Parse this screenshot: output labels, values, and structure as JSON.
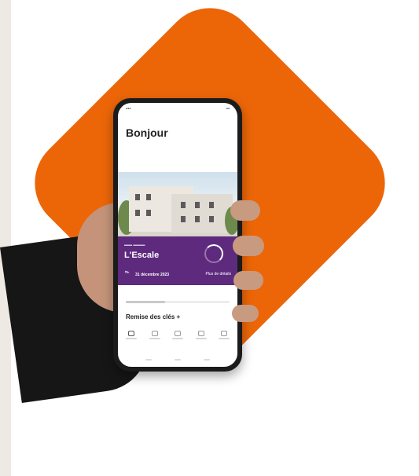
{
  "app": {
    "greeting": "Bonjour",
    "project": {
      "name": "L'Escale",
      "date_line": "31 décembre 2023",
      "detail_link": "Plus de détails"
    },
    "section_heading": "Remise des clés +",
    "icons": {
      "edit": "pencil-icon",
      "progress": "progress-ring-icon"
    }
  },
  "colors": {
    "brand_orange": "#ec6608",
    "card_purple": "#5e2a7e"
  }
}
